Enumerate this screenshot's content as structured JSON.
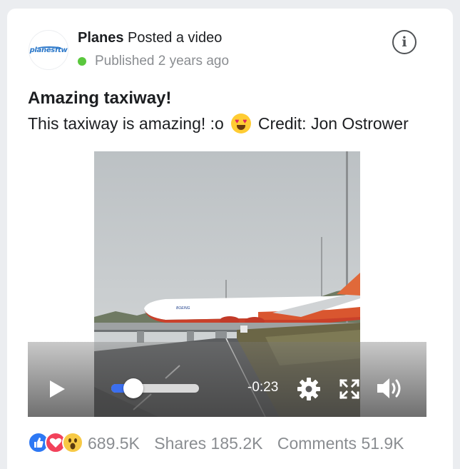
{
  "post": {
    "page_name": "Planes",
    "action": "Posted a video",
    "published": "Published 2 years ago",
    "avatar_logo_text": "planesftw",
    "title": "Amazing taxiway!",
    "description_before": "This taxiway is amazing! :o",
    "description_after": "Credit: Jon Ostrower",
    "emoji": "heart-eyes-emoji"
  },
  "video": {
    "time_remaining": "-0:23",
    "progress": 0.25,
    "plane_livery": "BOEING"
  },
  "stats": {
    "reactions_count": "689.5K",
    "shares": "Shares 185.2K",
    "comments": "Comments 51.9K"
  },
  "colors": {
    "accent": "#3b6ff0",
    "online": "#5ac73d",
    "muted_text": "#8a8d91",
    "like": "#2d78f4",
    "love": "#f2425b",
    "wow": "#f7c945"
  },
  "icons": [
    "info-icon",
    "play-icon",
    "gear-icon",
    "fullscreen-icon",
    "volume-icon",
    "like-icon",
    "love-icon",
    "wow-icon"
  ]
}
